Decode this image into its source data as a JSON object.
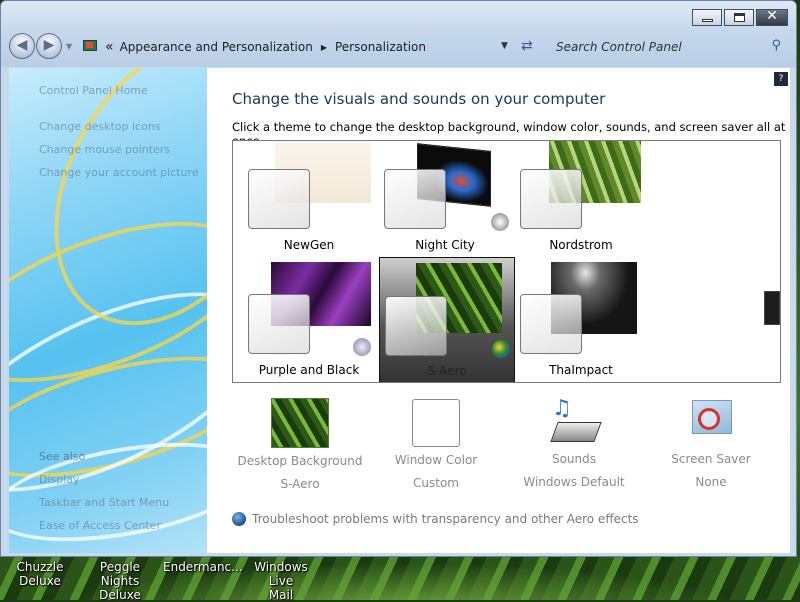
{
  "window": {
    "caption_buttons": [
      "minimize-icon",
      "maximize-icon",
      "close-icon"
    ]
  },
  "address": {
    "overflow": "«",
    "crumbs": [
      "Appearance and Personalization",
      "Personalization"
    ],
    "search_placeholder": "Search Control Panel"
  },
  "sidebar": {
    "home": "Control Panel Home",
    "links": [
      "Change desktop icons",
      "Change mouse pointers",
      "Change your account picture"
    ],
    "see_also": "See also",
    "see_also_links": [
      "Display",
      "Taskbar and Start Menu",
      "Ease of Access Center"
    ]
  },
  "main": {
    "title": "Change the visuals and sounds on your computer",
    "subtitle": "Click a theme to change the desktop background, window color, sounds, and screen saver all at once.",
    "themes": [
      {
        "name": "NewGen",
        "selected": false
      },
      {
        "name": "Night City",
        "selected": false
      },
      {
        "name": "Nordstrom",
        "selected": false
      },
      {
        "name": "Purple and Black",
        "selected": false
      },
      {
        "name": "S-Aero",
        "selected": true
      },
      {
        "name": "ThaImpact",
        "selected": false
      }
    ],
    "settings": [
      {
        "label": "Desktop Background",
        "value": "S-Aero",
        "icon": "leaves-thumbnail"
      },
      {
        "label": "Window Color",
        "value": "Custom",
        "icon": "color-swatch"
      },
      {
        "label": "Sounds",
        "value": "Windows Default",
        "icon": "music-notes-icon"
      },
      {
        "label": "Screen Saver",
        "value": "None",
        "icon": "screen-saver-none-icon"
      }
    ],
    "troubleshoot": "Troubleshoot problems with transparency and other Aero effects"
  },
  "desktop": {
    "icons": [
      {
        "line1": "Chuzzle",
        "line2": "Deluxe"
      },
      {
        "line1": "Peggle Nights",
        "line2": "Deluxe"
      },
      {
        "line1": "Endermanc...",
        "line2": ""
      },
      {
        "line1": "Windows Live",
        "line2": "Mail"
      }
    ]
  },
  "colors": {
    "title_blue": "#1e3960",
    "sidebar_blue": "#56c2f0",
    "accent_yellow": "#ffd640"
  }
}
